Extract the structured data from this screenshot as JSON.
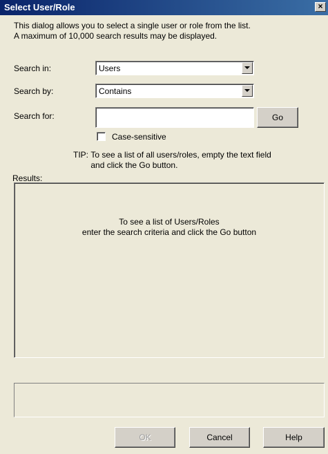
{
  "window": {
    "title": "Select User/Role",
    "close_glyph": "×"
  },
  "description": {
    "line1": "This dialog allows you to select a single user or role from the list.",
    "line2": "A maximum of 10,000 search results may be displayed."
  },
  "search_in": {
    "label": "Search in:",
    "value": "Users"
  },
  "search_by": {
    "label": "Search by:",
    "value": "Contains"
  },
  "search_for": {
    "label": "Search for:",
    "value": "",
    "go_label": "Go"
  },
  "case_sensitive": {
    "label": "Case-sensitive",
    "checked": false
  },
  "tip": {
    "prefix": "TIP:",
    "line1": "To see a list of all users/roles, empty the text field",
    "line2": "and click the Go button."
  },
  "results": {
    "label": "Results:",
    "empty_line1": "To see a list of Users/Roles",
    "empty_line2": "enter the search criteria and click the Go button"
  },
  "buttons": {
    "ok": "OK",
    "cancel": "Cancel",
    "help": "Help"
  },
  "colors": {
    "title_start": "#0a246a",
    "title_end": "#3a6ea5",
    "face": "#ece9d8"
  }
}
